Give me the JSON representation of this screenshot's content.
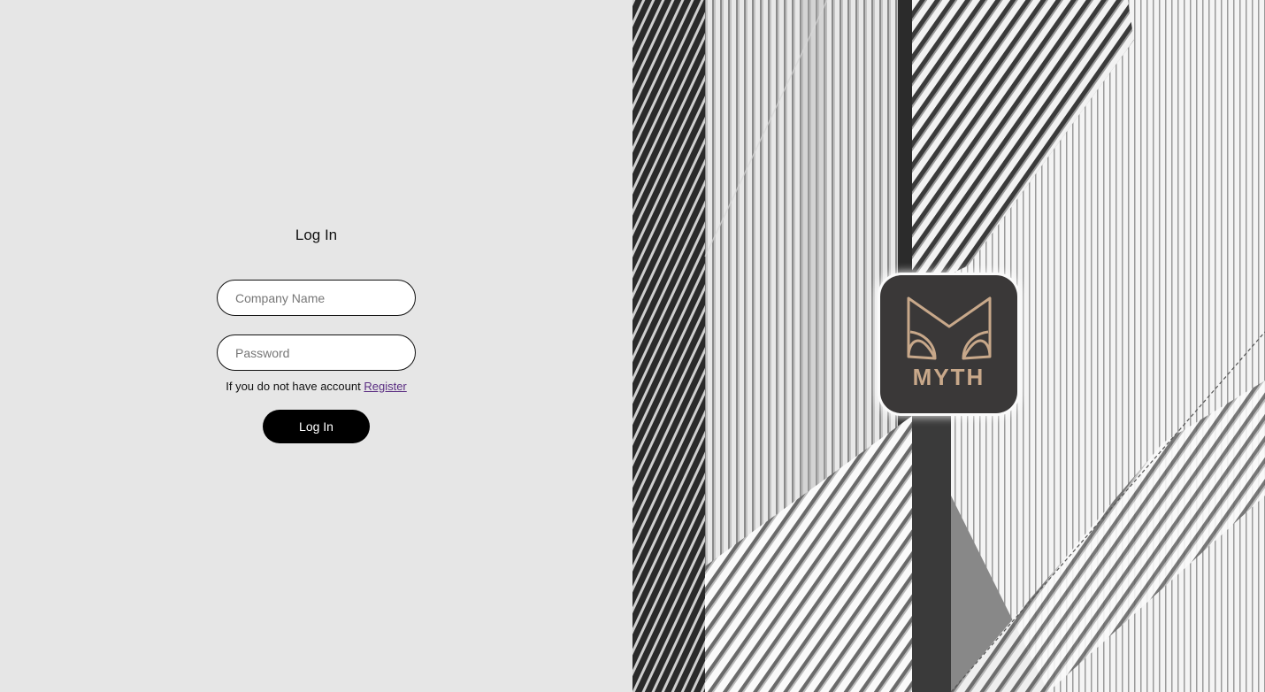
{
  "login": {
    "title": "Log In",
    "company_placeholder": "Company Name",
    "password_placeholder": "Password",
    "register_prompt": "If you do not have account ",
    "register_link": "Register",
    "submit_label": "Log In"
  },
  "brand": {
    "name": "MYTH",
    "accent": "#c8a88a",
    "logo_bg": "#3a3838"
  }
}
